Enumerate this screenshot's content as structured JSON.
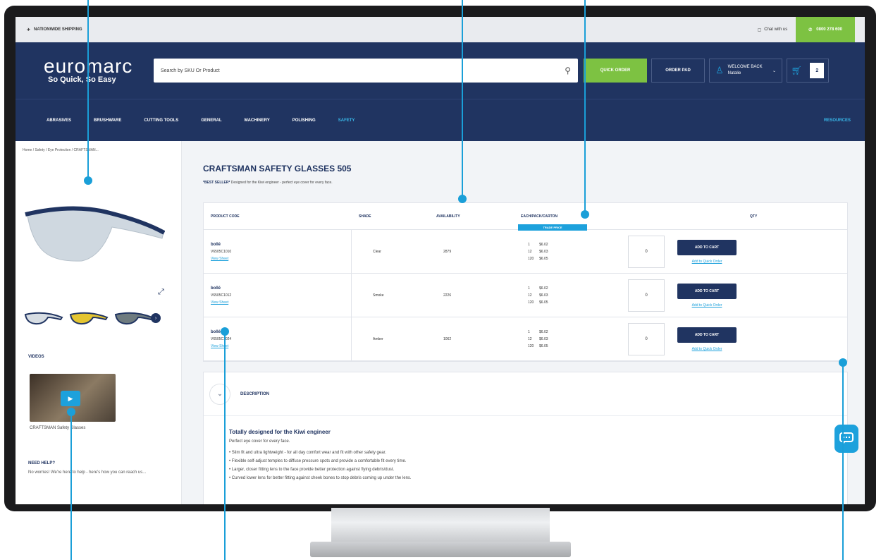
{
  "topbar": {
    "shipping": "NATIONWIDE SHIPPING",
    "chat": "Chat with us",
    "phone": "0800 278 600"
  },
  "header": {
    "logo_word": "euromarc",
    "logo_tagline": "So Quick, So Easy",
    "search_placeholder": "Search by SKU Or Product",
    "quick_order": "QUICK ORDER",
    "order_pad": "ORDER PAD",
    "welcome": "WELCOME BACK",
    "user": "Natalie",
    "cart_count": "2"
  },
  "nav": {
    "items": [
      "ABRASIVES",
      "BRUSHWARE",
      "CUTTING TOOLS",
      "GENERAL",
      "MACHINERY",
      "POLISHING",
      "SAFETY"
    ],
    "resources": "RESOURCES"
  },
  "sidebar": {
    "breadcrumb": "Home / Safety / Eye Protection / CRAFTSMAN...",
    "videos_heading": "VIDEOS",
    "video_caption": "CRAFTSMAN Safety Glasses",
    "help_heading": "NEED HELP?",
    "help_text": "No worries! We're here to help - here's how you can reach us..."
  },
  "product": {
    "title": "CRAFTSMAN SAFETY GLASSES 505",
    "bestseller": "*BEST SELLER*",
    "tagline": "Designed for the Kiwi engineer - perfect eye cover for every face."
  },
  "table": {
    "headers": {
      "code": "PRODUCT CODE",
      "shade": "SHADE",
      "availability": "AVAILABILITY",
      "price": "EACH/PACK/CARTON",
      "trade": "TRADE PRICE",
      "qty": "QTY"
    },
    "rows": [
      {
        "brand": "bollé",
        "code": "V6505C1010",
        "link": "View Sheet",
        "shade": "Clear",
        "availability": "2879",
        "t1": "1",
        "p1": "$6.02",
        "t2": "12",
        "p2": "$6.03",
        "t3": "120",
        "p3": "$6.05",
        "qty": "0"
      },
      {
        "brand": "bollé",
        "code": "V6505C1012",
        "link": "View Sheet",
        "shade": "Smoke",
        "availability": "2226",
        "t1": "1",
        "p1": "$6.02",
        "t2": "12",
        "p2": "$6.03",
        "t3": "120",
        "p3": "$6.05",
        "qty": "0"
      },
      {
        "brand": "bollé",
        "code": "V6505C1024",
        "link": "View Sheet",
        "shade": "Amber",
        "availability": "1062",
        "t1": "1",
        "p1": "$6.02",
        "t2": "12",
        "p2": "$6.03",
        "t3": "120",
        "p3": "$6.05",
        "qty": "0"
      }
    ],
    "add_to_cart": "ADD TO CART",
    "quick_order": "Add to Quick Order"
  },
  "description": {
    "heading": "DESCRIPTION",
    "title": "Totally designed for the Kiwi engineer",
    "intro": "Perfect eye cover for every face.",
    "bullets": [
      "Slim fit and ultra lightweight - for all day comfort wear and fit with other safety gear.",
      "Flexible self-adjust temples to diffuse pressure spots and provide a comfortable fit every time.",
      "Larger, closer fitting lens to the face provide better protection against flying debris/dust.",
      "Curved lower lens for better fitting against cheek bones to stop debris coming up under the lens."
    ]
  },
  "colors": {
    "navy": "#203461",
    "green": "#7dc242",
    "accent": "#1da1dc"
  }
}
